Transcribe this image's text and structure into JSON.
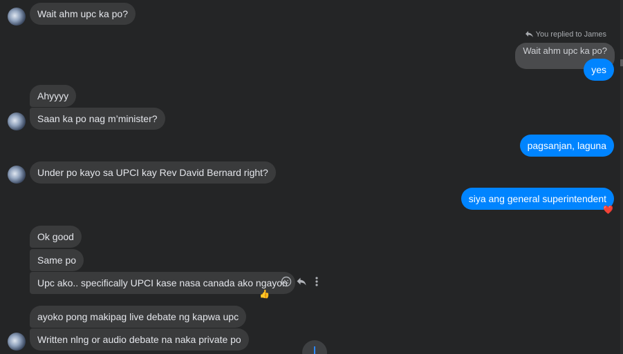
{
  "conversation": {
    "reply_label": "You replied to James",
    "quoted_text": "Wait ahm upc ka po?",
    "messages": [
      {
        "text": "Wait ahm upc ka po?"
      },
      {
        "text": "yes"
      },
      {
        "text": "Ahyyyy"
      },
      {
        "text": "Saan ka po nag m’minister?"
      },
      {
        "text": "pagsanjan, laguna"
      },
      {
        "text": "Under po kayo sa UPCI kay Rev David Bernard right?"
      },
      {
        "text": "siya ang general superintendent"
      },
      {
        "text": "Ok good"
      },
      {
        "text": "Same po"
      },
      {
        "text": "Upc ako.. specifically UPCI kase nasa canada ako ngayon"
      },
      {
        "text": "ayoko pong makipag live debate ng kapwa upc"
      },
      {
        "text": "Written nlng or audio debate na naka private po"
      }
    ],
    "reactions": {
      "superintendent": "❤️",
      "upc_ako": "👍"
    }
  },
  "icons": {
    "reply": "reply-icon",
    "emoji": "emoji-icon",
    "more": "more-options-icon",
    "scroll_down": "chevron-down-icon"
  },
  "colors": {
    "background": "#242526",
    "incoming_bubble": "#3a3b3c",
    "outgoing_bubble": "#0084ff"
  }
}
